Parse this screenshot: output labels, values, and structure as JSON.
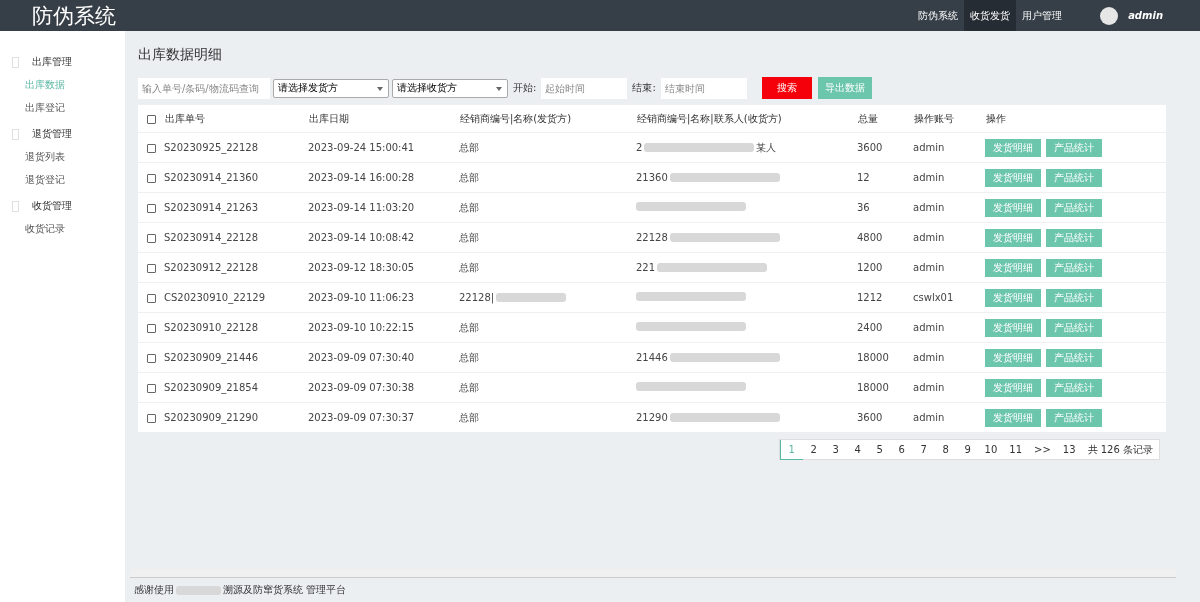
{
  "header": {
    "title": "防伪系统",
    "nav": [
      {
        "label": "防伪系统",
        "selected": false
      },
      {
        "label": "收货发货",
        "selected": true
      },
      {
        "label": "用户管理",
        "selected": false
      }
    ],
    "user": "admin"
  },
  "sidebar": [
    {
      "label": "出库管理",
      "items": [
        {
          "label": "出库数据",
          "selected": true
        },
        {
          "label": "出库登记",
          "selected": false
        }
      ]
    },
    {
      "label": "退货管理",
      "items": [
        {
          "label": "退货列表",
          "selected": false
        },
        {
          "label": "退货登记",
          "selected": false
        }
      ]
    },
    {
      "label": "收货管理",
      "items": [
        {
          "label": "收货记录",
          "selected": false
        }
      ]
    }
  ],
  "page_title": "出库数据明细",
  "filters": {
    "search_placeholder": "输入单号/条码/物流码查询",
    "sender_select": "请选择发货方",
    "receiver_select": "请选择收货方",
    "start_label": "开始:",
    "start_placeholder": "起始时间",
    "end_label": "结束:",
    "end_placeholder": "结束时间",
    "search_button": "搜索",
    "export_button": "导出数据"
  },
  "table": {
    "select_all_checked": false,
    "columns": [
      "出库单号",
      "出库日期",
      "经销商编号|名称(发货方)",
      "经销商编号|名称|联系人(收货方)",
      "总量",
      "操作账号",
      "操作"
    ],
    "rows": [
      {
        "checked": false,
        "order": "S20230925_22128",
        "date": "2023-09-24 15:00:41",
        "sender": {
          "text": "总部"
        },
        "receiver": {
          "prefix": "2",
          "suffix": "某人",
          "redacted": true
        },
        "total": "3600",
        "account": "admin",
        "actions": [
          "发货明细",
          "产品统计"
        ]
      },
      {
        "checked": false,
        "order": "S20230914_21360",
        "date": "2023-09-14 16:00:28",
        "sender": {
          "text": "总部"
        },
        "receiver": {
          "prefix": "21360",
          "redacted": true
        },
        "total": "12",
        "account": "admin",
        "actions": [
          "发货明细",
          "产品统计"
        ]
      },
      {
        "checked": false,
        "order": "S20230914_21263",
        "date": "2023-09-14 11:03:20",
        "sender": {
          "text": "总部"
        },
        "receiver": {
          "redacted": true
        },
        "total": "36",
        "account": "admin",
        "actions": [
          "发货明细",
          "产品统计"
        ]
      },
      {
        "checked": false,
        "order": "S20230914_22128",
        "date": "2023-09-14 10:08:42",
        "sender": {
          "text": "总部"
        },
        "receiver": {
          "prefix": "22128",
          "redacted": true
        },
        "total": "4800",
        "account": "admin",
        "actions": [
          "发货明细",
          "产品统计"
        ]
      },
      {
        "checked": false,
        "order": "S20230912_22128",
        "date": "2023-09-12 18:30:05",
        "sender": {
          "text": "总部"
        },
        "receiver": {
          "prefix": "221",
          "redacted": true
        },
        "total": "1200",
        "account": "admin",
        "actions": [
          "发货明细",
          "产品统计"
        ]
      },
      {
        "checked": false,
        "order": "CS20230910_22129",
        "date": "2023-09-10 11:06:23",
        "sender": {
          "text": "22128|",
          "redacted": true
        },
        "receiver": {
          "redacted": true
        },
        "total": "1212",
        "account": "cswlx01",
        "actions": [
          "发货明细",
          "产品统计"
        ]
      },
      {
        "checked": false,
        "order": "S20230910_22128",
        "date": "2023-09-10 10:22:15",
        "sender": {
          "text": "总部"
        },
        "receiver": {
          "redacted": true
        },
        "total": "2400",
        "account": "admin",
        "actions": [
          "发货明细",
          "产品统计"
        ]
      },
      {
        "checked": false,
        "order": "S20230909_21446",
        "date": "2023-09-09 07:30:40",
        "sender": {
          "text": "总部"
        },
        "receiver": {
          "prefix": "21446",
          "redacted": true
        },
        "total": "18000",
        "account": "admin",
        "actions": [
          "发货明细",
          "产品统计"
        ]
      },
      {
        "checked": false,
        "order": "S20230909_21854",
        "date": "2023-09-09 07:30:38",
        "sender": {
          "text": "总部"
        },
        "receiver": {
          "redacted": true
        },
        "total": "18000",
        "account": "admin",
        "actions": [
          "发货明细",
          "产品统计"
        ]
      },
      {
        "checked": false,
        "order": "S20230909_21290",
        "date": "2023-09-09 07:30:37",
        "sender": {
          "text": "总部"
        },
        "receiver": {
          "prefix": "21290",
          "redacted": true
        },
        "total": "3600",
        "account": "admin",
        "actions": [
          "发货明细",
          "产品统计"
        ]
      }
    ]
  },
  "pagination": {
    "pages": [
      {
        "label": "1",
        "selected": true
      },
      {
        "label": "2",
        "selected": false
      },
      {
        "label": "3",
        "selected": false
      },
      {
        "label": "4",
        "selected": false
      },
      {
        "label": "5",
        "selected": false
      },
      {
        "label": "6",
        "selected": false
      },
      {
        "label": "7",
        "selected": false
      },
      {
        "label": "8",
        "selected": false
      },
      {
        "label": "9",
        "selected": false
      },
      {
        "label": "10",
        "selected": false
      },
      {
        "label": "11",
        "selected": false
      },
      {
        "label": ">>",
        "selected": false
      },
      {
        "label": "13",
        "selected": false
      }
    ],
    "total": "共 126 条记录"
  },
  "footer": {
    "before": "感谢使用",
    "after": "溯源及防窜货系统 管理平台"
  }
}
